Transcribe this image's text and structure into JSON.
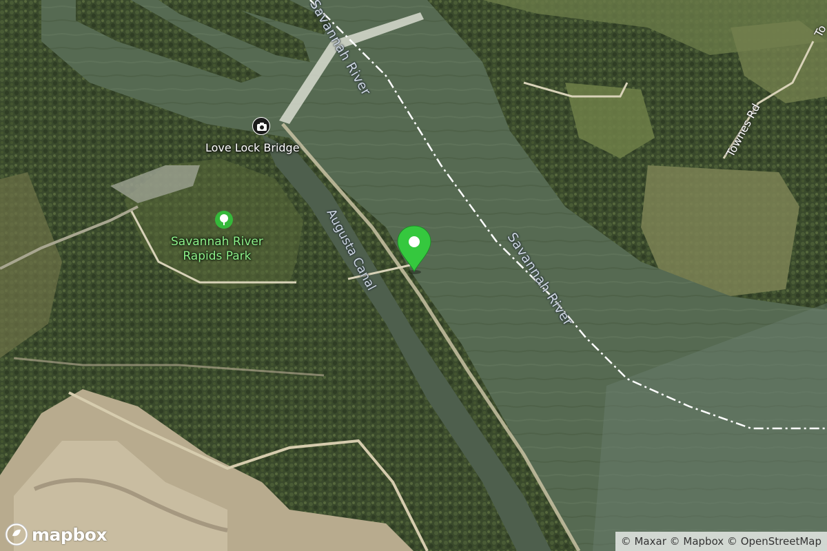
{
  "map": {
    "type": "satellite",
    "labels": {
      "river_top": "Savannah River",
      "river_middle": "Savannah River",
      "canal": "Augusta Canal",
      "road": "Townes Rd",
      "road_partial": "To"
    },
    "pois": {
      "love_lock_bridge": "Love Lock Bridge",
      "park_name_line1": "Savannah River",
      "park_name_line2": "Rapids Park"
    },
    "marker": {
      "color": "#35c83e"
    },
    "colors": {
      "river": "#536450",
      "forest": "#3b4a2c",
      "boundary": "#ffffff",
      "park_label": "#8ef08a"
    }
  },
  "footer": {
    "logo_text": "mapbox",
    "attribution": "© Maxar © Mapbox © OpenStreetMap"
  }
}
